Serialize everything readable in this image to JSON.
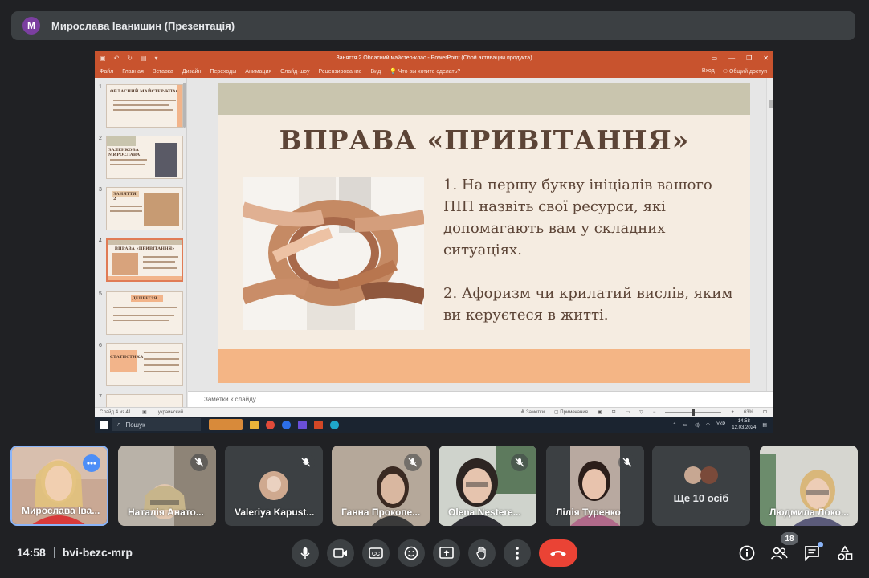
{
  "presenter_bar": {
    "avatar_letter": "M",
    "title": "Мирослава Іванишин (Презентація)"
  },
  "powerpoint": {
    "document_title": "Заняття 2 Обласний майстер-клас - PowerPoint (Сбой активации продукта)",
    "ribbon_tabs": [
      "Файл",
      "Главная",
      "Вставка",
      "Дизайн",
      "Переходы",
      "Анимация",
      "Слайд-шоу",
      "Рецензирование",
      "Вид"
    ],
    "tell_me": "Что вы хотите сделать?",
    "ribbon_right": {
      "signin": "Вход",
      "share": "Общий доступ"
    },
    "thumbnails": [
      {
        "num": "1",
        "title": "ОБЛАСНИЙ МАЙСТЕР-КЛАС"
      },
      {
        "num": "2",
        "title": "ЗАЛЕНКОВА МИРОСЛАВА"
      },
      {
        "num": "3",
        "title": "ЗАНЯТТЯ 2"
      },
      {
        "num": "4",
        "title": "ВПРАВА «ПРИВІТАННЯ»"
      },
      {
        "num": "5",
        "title": "ДЕПРЕСІЯ"
      },
      {
        "num": "6",
        "title": "СТАТИСТИКА"
      },
      {
        "num": "7",
        "title": ""
      }
    ],
    "slide": {
      "heading": "ВПРАВА «ПРИВІТАННЯ»",
      "point1": "1. На першу букву ініціалів вашого ПІП назвіть свої ресурси, які допомагають вам у складних ситуаціях.",
      "point2": "2. Афоризм чи крилатий вислів, яким ви керуєтеся в житті."
    },
    "notes_placeholder": "Заметки к слайду",
    "status": {
      "slide_counter": "Слайд 4 из 41",
      "language": "украинский",
      "notes_btn": "Заметки",
      "comments_btn": "Примечания",
      "zoom": "63%"
    }
  },
  "taskbar": {
    "search_placeholder": "Пошук",
    "lang": "УКР",
    "time": "14:58",
    "date": "12.03.2024"
  },
  "participants": [
    {
      "name": "Мирослава Іва...",
      "muted": false,
      "active": true
    },
    {
      "name": "Наталія Анато...",
      "muted": true
    },
    {
      "name": "Valeriya Kapust...",
      "muted": true
    },
    {
      "name": "Ганна Прокопе...",
      "muted": true
    },
    {
      "name": "Olena Nestere...",
      "muted": true
    },
    {
      "name": "Лілія Туренко",
      "muted": true
    },
    {
      "name": "Ще 10 осіб"
    },
    {
      "name": "Людмила Локо..."
    }
  ],
  "bottom_bar": {
    "time": "14:58",
    "meeting_code": "bvi-bezc-mrp",
    "participants_count": "18"
  },
  "colors": {
    "background": "#202124",
    "tile": "#3c4043",
    "end_call": "#ea4335",
    "accent_blue": "#8ab4f8",
    "powerpoint_orange": "#c8532e"
  }
}
